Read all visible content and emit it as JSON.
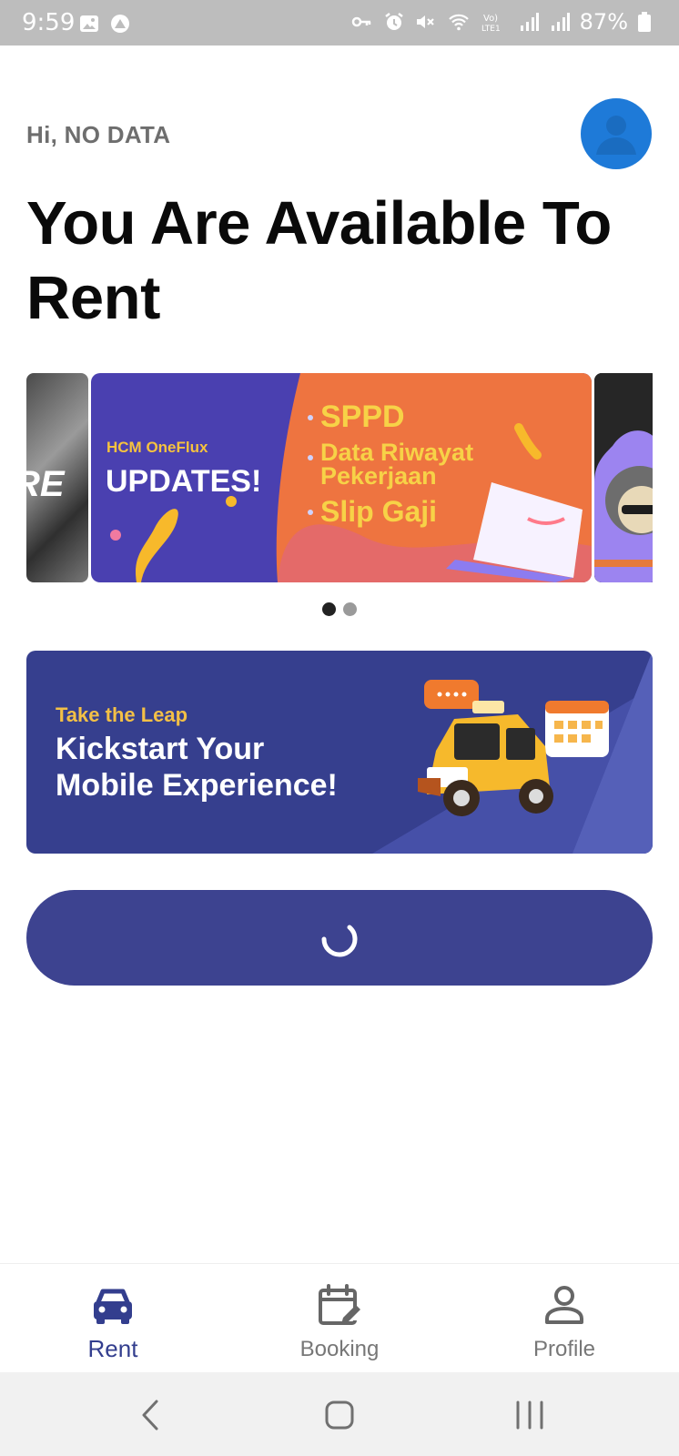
{
  "status_bar": {
    "time": "9:59",
    "battery": "87%",
    "icons": [
      "image-icon",
      "app-notification-icon",
      "vpn-key-icon",
      "alarm-icon",
      "mute-icon",
      "wifi-icon",
      "volte-icon",
      "signal-icon",
      "signal-icon",
      "battery-icon"
    ]
  },
  "header": {
    "greeting": "Hi, NO DATA",
    "headline": "You Are Available To Rent",
    "avatar_icon": "person-icon"
  },
  "carousel": {
    "prev_slide_text": "RE",
    "main_slide": {
      "brand": "HCM OneFlux",
      "title": "UPDATES!",
      "items": [
        "SPPD",
        "Data Riwayat Pekerjaan",
        "Slip Gaji"
      ]
    },
    "page_count": 2,
    "active_index": 0
  },
  "promo": {
    "subtitle": "Take the Leap",
    "title_line1": "Kickstart Your",
    "title_line2": "Mobile Experience!"
  },
  "loading_button": {
    "state": "loading"
  },
  "bottom_nav": {
    "items": [
      {
        "label": "Rent",
        "icon": "car-icon",
        "active": true
      },
      {
        "label": "Booking",
        "icon": "calendar-edit-icon",
        "active": false
      },
      {
        "label": "Profile",
        "icon": "person-icon",
        "active": false
      }
    ]
  },
  "colors": {
    "primary": "#3d4390",
    "avatar": "#1e7ad8",
    "accent_yellow": "#f6c23e"
  }
}
